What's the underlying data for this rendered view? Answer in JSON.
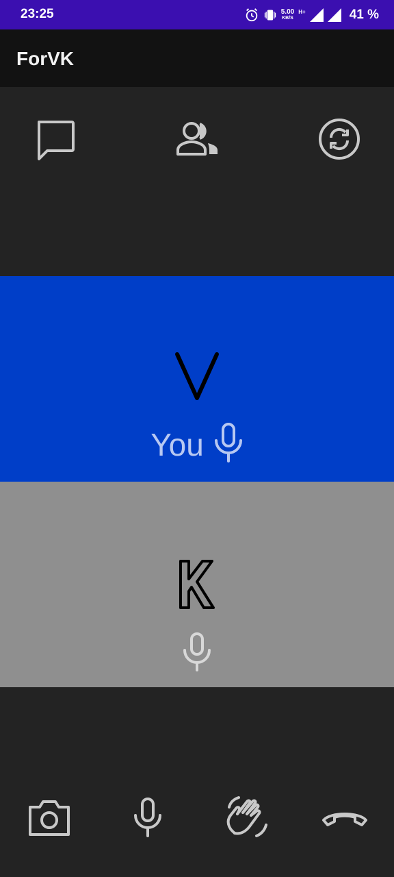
{
  "status_bar": {
    "time": "23:25",
    "net_speed_value": "5.00",
    "net_speed_unit": "KB/S",
    "network_type": "H+",
    "battery": "41 %",
    "icons": [
      "alarm-icon",
      "vibrate-icon",
      "signal-icon",
      "signal-icon"
    ]
  },
  "app_bar": {
    "title": "ForVK"
  },
  "top_actions": {
    "items": [
      {
        "name": "chat-icon"
      },
      {
        "name": "participants-icon"
      },
      {
        "name": "switch-camera-icon"
      }
    ]
  },
  "participants": [
    {
      "letter": "V",
      "label": "You",
      "color": "#003ec8",
      "mic_icon": "microphone-icon"
    },
    {
      "letter": "K",
      "label": "",
      "color": "#8f8f8f",
      "mic_icon": "microphone-icon"
    }
  ],
  "bottom_controls": {
    "items": [
      {
        "name": "camera-icon"
      },
      {
        "name": "microphone-icon"
      },
      {
        "name": "raise-hand-icon"
      },
      {
        "name": "end-call-icon"
      }
    ]
  },
  "colors": {
    "status_bar": "#3b0fb0",
    "app_bar": "#121212",
    "background": "#232323",
    "icon": "#c8c8c8"
  }
}
